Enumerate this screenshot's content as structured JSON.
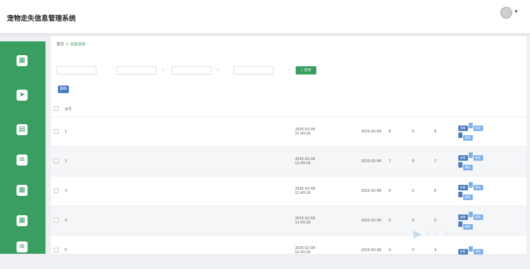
{
  "app": {
    "title": "宠物走失信息管理系统"
  },
  "breadcrumb": {
    "home": "首页",
    "current": "失踪宠物"
  },
  "filters": {
    "delete_label": "删除",
    "search_label": "查询"
  },
  "table": {
    "columns": [
      "序号"
    ],
    "rows": [
      {
        "index": "1",
        "time": "2025-02-09 11:43:16",
        "date": "2025-02-09",
        "clicks": "8",
        "comments": "0",
        "collects": "8"
      },
      {
        "index": "2",
        "time": "2025-02-09 11:43:16",
        "date": "2025-02-09",
        "clicks": "7",
        "comments": "0",
        "collects": "7"
      },
      {
        "index": "3",
        "time": "2025-02-09 11:43:16",
        "date": "2025-02-09",
        "clicks": "6",
        "comments": "0",
        "collects": "6"
      },
      {
        "index": "4",
        "time": "2025-02-09 11:43:16",
        "date": "2025-02-09",
        "clicks": "5",
        "comments": "0",
        "collects": "5"
      },
      {
        "index": "5",
        "time": "2025-02-09 11:43:16",
        "date": "2025-02-09",
        "clicks": "4",
        "comments": "0",
        "collects": "4"
      }
    ],
    "actions": {
      "view": "查看",
      "edit": "修改",
      "delete": "删除"
    }
  },
  "colors": {
    "sidebar": "#3a9e61",
    "primary_button": "#4a7bbf",
    "secondary_button": "#7fb0e6"
  }
}
